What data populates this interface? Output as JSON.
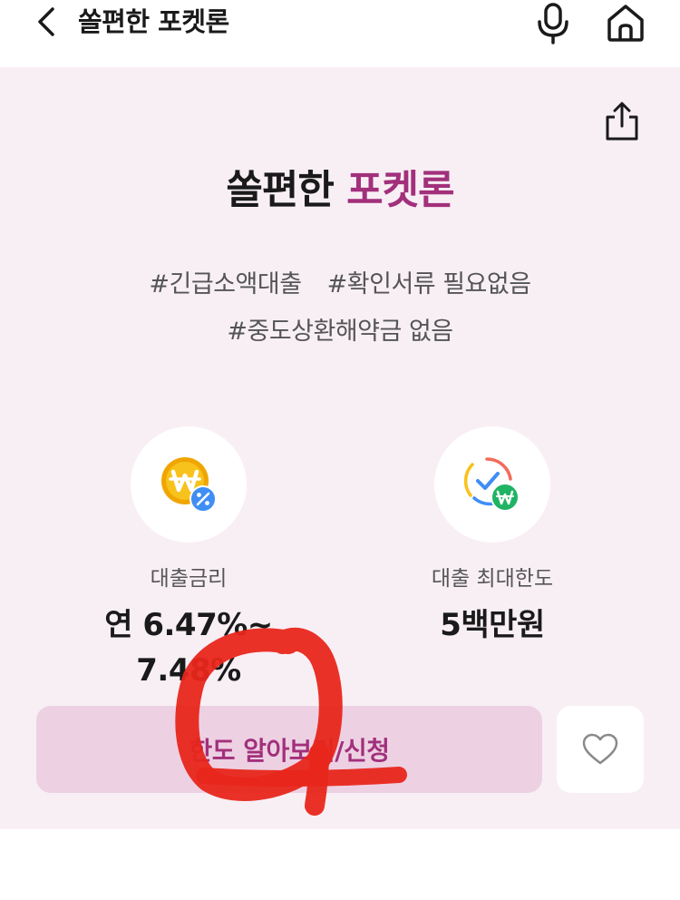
{
  "header": {
    "title": "쏠편한 포켓론",
    "icons": [
      "chevron-left-icon",
      "microphone-icon",
      "home-icon"
    ]
  },
  "product": {
    "name_main": "쏠편한",
    "name_accent": "포켓론",
    "accent_color": "#a2307b",
    "tags": [
      "#긴급소액대출",
      "#확인서류 필요없음",
      "#중도상환해약금 없음"
    ]
  },
  "features": [
    {
      "label": "대출금리",
      "value": "연 6.47%~ 7.48%",
      "icon": "won-percent-coin-icon"
    },
    {
      "label": "대출 최대한도",
      "value": "5백만원",
      "icon": "won-check-circle-icon"
    }
  ],
  "actions": {
    "apply_label": "한도 알아보기/신청",
    "favorite_icon": "heart-icon",
    "share_icon": "share-icon"
  },
  "annotation": {
    "color": "#e8261b"
  }
}
